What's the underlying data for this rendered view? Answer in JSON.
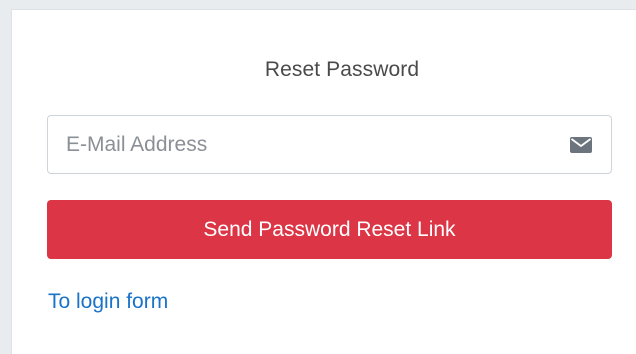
{
  "page": {
    "title": "Reset Password"
  },
  "form": {
    "email_placeholder": "E-Mail Address",
    "email_value": "",
    "email_icon": "envelope-icon",
    "submit_label": "Send Password Reset Link",
    "login_link_label": "To login form"
  },
  "colors": {
    "button_bg": "#dc3545",
    "link": "#1a73c8",
    "background": "#e9ecef",
    "card": "#ffffff"
  }
}
